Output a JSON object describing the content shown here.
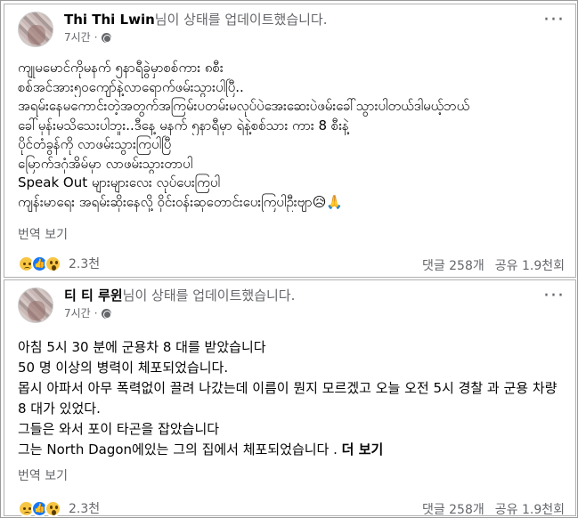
{
  "posts": [
    {
      "author": "Thi Thi Lwin",
      "action": "님이 상태를 업데이트했습니다.",
      "time": "7시간",
      "privacy_icon": "globe-icon",
      "more_icon": "ellipsis-icon",
      "lines": [
        "ကျုမမောင်ကိုမနက် ၅နာရီခွဲမှာစစ်ကား ၈စီး",
        "စစ်အင်အား၅၀ကျော်နဲ့လာရောက်ဖမ်းသွားပါပြီ..",
        "အရမ်းနေမကောင်းတဲ့အတွက်အကြမ်းပတမ်းမလုပ်ပဲအေးဆေးပဲဖမ်းခေါ်သွားပါတယ်ဒါမယ့်ဘယ်",
        "ခေါ်မှန်းမသိသေးပါဘူး..ဒီနေ့ မနက် ၅နာရီမှာ ရဲနဲ့စစ်သား ကား 8 စီးနဲ့",
        "ပိုင်တံခွန်ကို လာဖမ်းသွားကြပါပြီ",
        "မြောက်ဒဂုံအိမ်မှာ လာဖမ်းသွားတာပါ",
        "Speak Out များများလေး လုပ်ပေးကြပါ",
        "ကျန်းမာရေး အရမ်းဆိုးနေလို့ ဝိုင်းဝန်းဆုတောင်းပေးကြပါဦးဗျာ😥🙏"
      ],
      "see_more": "",
      "translate": "번역 보기",
      "reaction_count": "2.3천",
      "comments": "댓글 258개",
      "shares": "공유 1.9천회"
    },
    {
      "author": "티 티 루윈",
      "action": "님이 상태를 업데이트했습니다.",
      "time": "7시간",
      "privacy_icon": "globe-icon",
      "more_icon": "ellipsis-icon",
      "lines": [
        "아침 5시 30 분에 군용차 8 대를 받았습니다",
        "50 명 이상의 병력이 체포되었습니다.",
        "몹시 아파서 아무 폭력없이 끌려 나갔는데 이름이 뭔지 모르겠고 오늘 오전 5시 경찰 과 군용 차량 8 대가 있었다.",
        "그들은 와서 포이 타곤을 잡았습니다",
        "그는 North Dagon에있는 그의 집에서 체포되었습니다 ."
      ],
      "see_more": "더 보기",
      "translate": "번역 보기",
      "reaction_count": "2.3천",
      "comments": "댓글 258개",
      "shares": "공유 1.9천회"
    }
  ],
  "colors": {
    "secondary_text": "#65676b",
    "like_blue": "#1877f2",
    "emoji_yellow": "#f7c544"
  }
}
